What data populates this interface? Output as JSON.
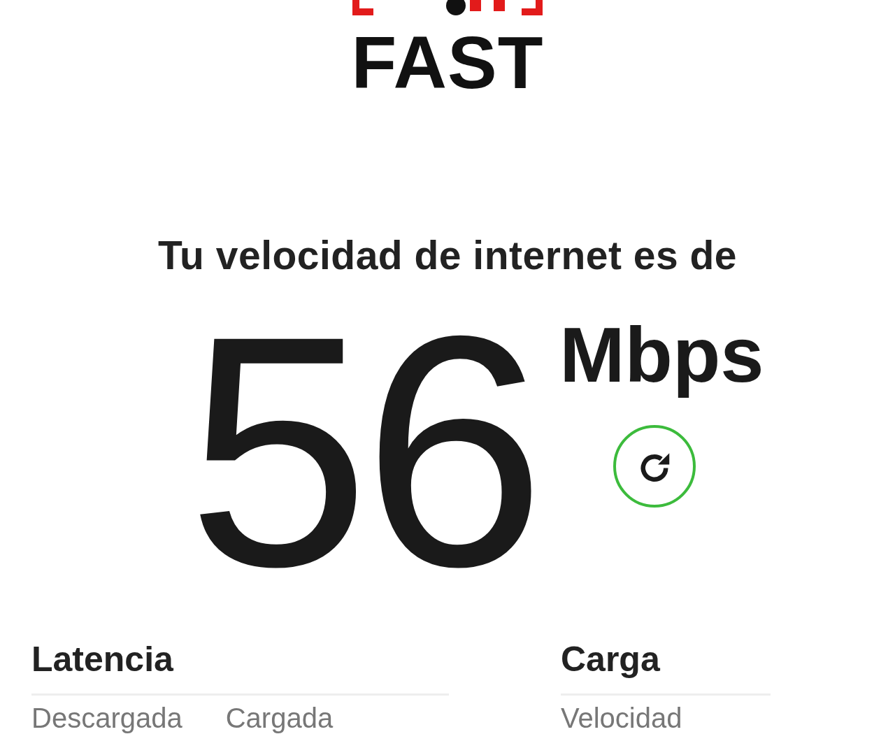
{
  "logo": {
    "text": "FAST"
  },
  "heading": "Tu velocidad de internet es de",
  "speed": {
    "value": "56",
    "unit": "Mbps"
  },
  "refresh_button": {
    "kind": "refresh"
  },
  "sections": [
    {
      "title": "Latencia",
      "labels": [
        "Descargada",
        "Cargada"
      ]
    },
    {
      "title": "Carga",
      "labels": [
        "Velocidad"
      ]
    }
  ]
}
